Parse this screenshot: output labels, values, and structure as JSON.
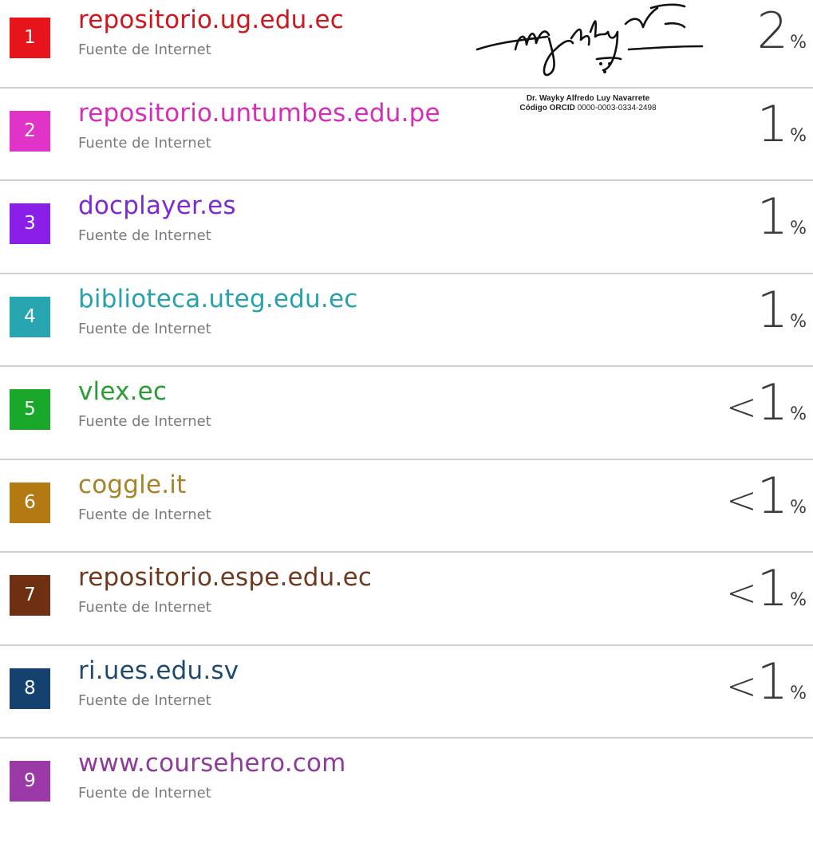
{
  "sources": [
    {
      "index": "1",
      "title": "repositorio.ug.edu.ec",
      "subtitle": "Fuente de Internet",
      "prefix": "",
      "value": "2",
      "unit": "%",
      "color": "#e8141b",
      "title_color": "#d0161c"
    },
    {
      "index": "2",
      "title": "repositorio.untumbes.edu.pe",
      "subtitle": "Fuente de Internet",
      "prefix": "",
      "value": "1",
      "unit": "%",
      "color": "#e033c7",
      "title_color": "#d62db8"
    },
    {
      "index": "3",
      "title": "docplayer.es",
      "subtitle": "Fuente de Internet",
      "prefix": "",
      "value": "1",
      "unit": "%",
      "color": "#8a1fe8",
      "title_color": "#7e2ad4"
    },
    {
      "index": "4",
      "title": "biblioteca.uteg.edu.ec",
      "subtitle": "Fuente de Internet",
      "prefix": "",
      "value": "1",
      "unit": "%",
      "color": "#27a6b2",
      "title_color": "#27a2ab"
    },
    {
      "index": "5",
      "title": "vlex.ec",
      "subtitle": "Fuente de Internet",
      "prefix": "<",
      "value": "1",
      "unit": "%",
      "color": "#19a82a",
      "title_color": "#2a9b35"
    },
    {
      "index": "6",
      "title": "coggle.it",
      "subtitle": "Fuente de Internet",
      "prefix": "<",
      "value": "1",
      "unit": "%",
      "color": "#b37a14",
      "title_color": "#a8832a"
    },
    {
      "index": "7",
      "title": "repositorio.espe.edu.ec",
      "subtitle": "Fuente de Internet",
      "prefix": "<",
      "value": "1",
      "unit": "%",
      "color": "#6e2f12",
      "title_color": "#6e3a1f"
    },
    {
      "index": "8",
      "title": "ri.ues.edu.sv",
      "subtitle": "Fuente de Internet",
      "prefix": "<",
      "value": "1",
      "unit": "%",
      "color": "#14416e",
      "title_color": "#1f4a70"
    },
    {
      "index": "9",
      "title": "www.coursehero.com",
      "subtitle": "Fuente de Internet",
      "prefix": "",
      "value": "",
      "unit": "",
      "color": "#9b3aa6",
      "title_color": "#8e3c9a"
    }
  ],
  "signature": {
    "name": "Dr. Wayky Alfredo Luy Navarrete",
    "orcid_label": "Código ORCID",
    "orcid_value": "0000-0003-0334-2498",
    "ink_color": "#111111"
  }
}
